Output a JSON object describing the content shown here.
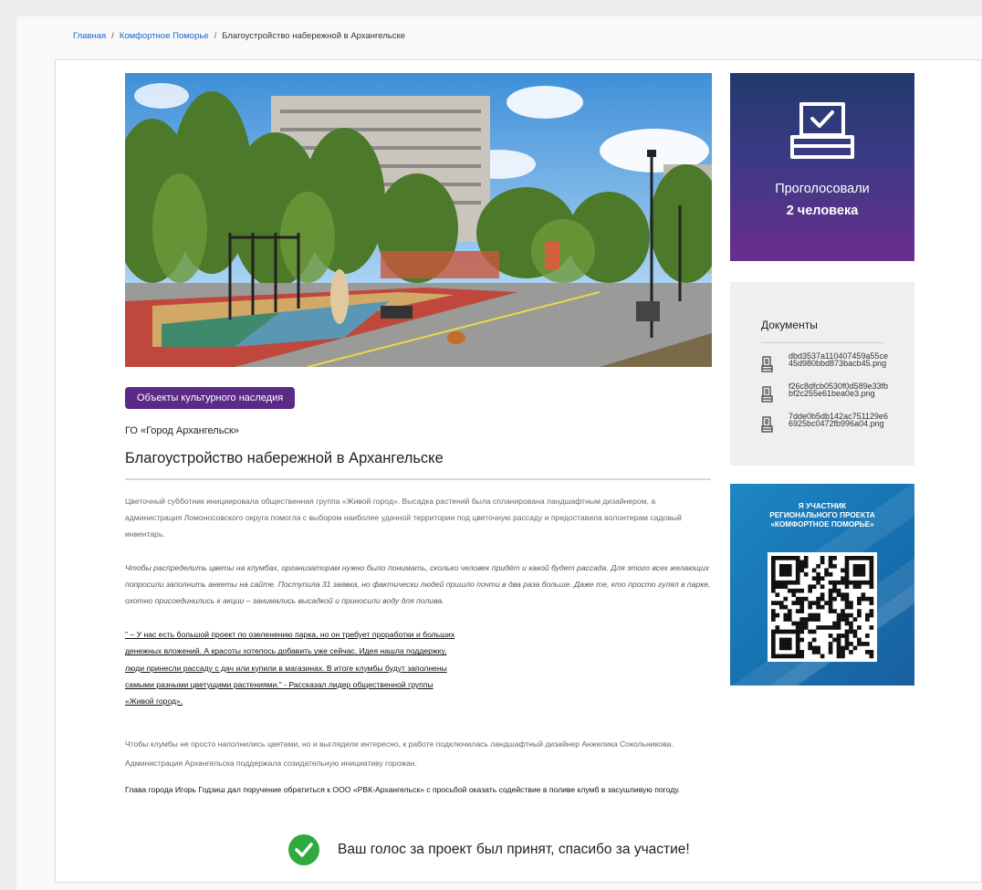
{
  "breadcrumb": {
    "home": "Главная",
    "section": "Комфортное Поморье",
    "current": "Благоустройство набережной в Архангельске",
    "separator": "/"
  },
  "project": {
    "tag": "Объекты культурного наследия",
    "organization": "ГО «Город Архангельск»",
    "title": "Благоустройство набережной в Архангельске"
  },
  "article": {
    "p1": "Цветочный субботник инициировала общественная группа «Живой город». Высадка растений была спланирована ландшафтным дизайнером, а администрация Ломоносовского округа помогла с выбором наиболее удачной территории под цветочную рассаду и предоставила волонтерам садовый инвентарь.",
    "p2": "Чтобы распределить цветы на клумбах, организаторам нужно было понимать, сколько человек придёт и какой будет рассада. Для этого всех желающих попросили заполнить анкеты на  сайте. Поступила 31 заявка, но фактически людей пришло почти в два раза больше. Даже те, кто просто гулял в парке, охотно присоединились к акции – занимались высадкой и приносили воду для полива.",
    "quote_lines": [
      "\" – У нас есть большой проект по озеленению парка, но он требует проработки и больших",
      "денежных вложений. А красоты хотелось добавить уже сейчас. Идея нашла поддержку,",
      "люди принесли рассаду с дач или купили в магазинах. В итоге клумбы будут заполнены",
      "самыми разными цветущими растениями.\" - Рассказал лидер общественной группы",
      "«Живой город»."
    ],
    "p3": "Чтобы клумбы не просто наполнились цветами, но и выглядели интересно, к работе подключилась ландшафтный дизайнер Анжелика Сокольникова. Администрация Архангельска поддержала созидательную инициативу горожан.",
    "p4": "Глава города Игорь Годзиш дал поручение обратиться к ООО «РВК-Архангельск» с просьбой оказать содействие в поливе клумб в засушливую погоду."
  },
  "vote_confirmation": "Ваш голос за проект был принят, спасибо за участие!",
  "vote_box": {
    "label": "Проголосовали",
    "count": "2 человека"
  },
  "documents": {
    "heading": "Документы",
    "files": [
      "dbd3537a110407459a55ce45d980bbd873bacb45.png",
      "f26c8dfcb0530f0d589e33fbbf2c255e61bea0e3.png",
      "7dde0b5db142ac751129e66925bc0472fb996a04.png"
    ]
  },
  "promo": {
    "line1": "Я УЧАСТНИК",
    "line2": "РЕГИОНАЛЬНОГО ПРОЕКТА",
    "line3": "«КОМФОРТНОЕ ПОМОРЬЕ»"
  },
  "colors": {
    "tag": "#5b2a86",
    "link": "#1a63c9",
    "check": "#2eaa3f",
    "promo": "#1671b0"
  },
  "icons": {
    "vote": "ballot-box-icon",
    "document": "document-icon",
    "success": "checkmark-icon"
  }
}
